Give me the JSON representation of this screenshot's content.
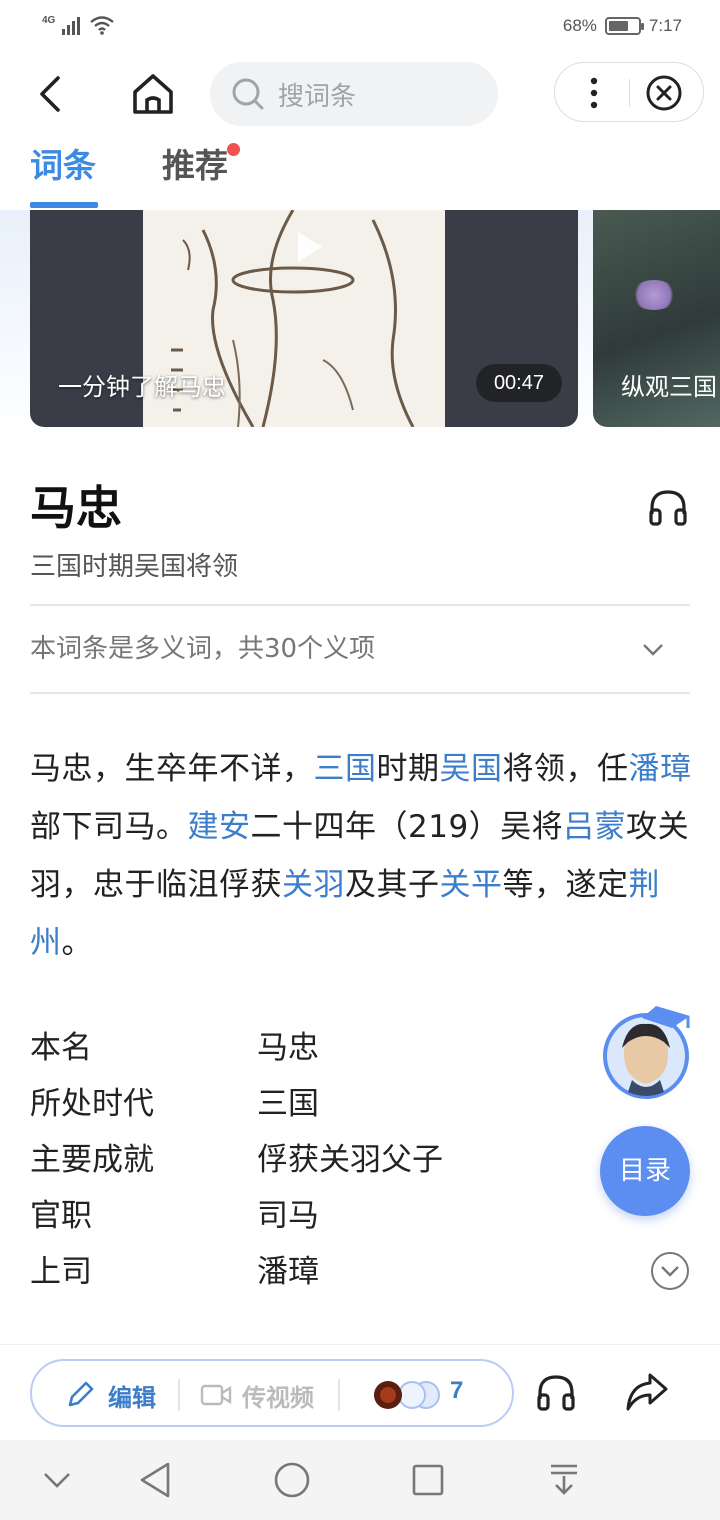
{
  "status": {
    "network": "4G",
    "battery": "68%",
    "battery_level": 0.68,
    "time": "7:17"
  },
  "search": {
    "placeholder": "搜词条"
  },
  "tabs": [
    {
      "label": "词条",
      "active": true
    },
    {
      "label": "推荐",
      "has_dot": true
    }
  ],
  "videos": [
    {
      "caption": "一分钟了解马忠",
      "duration": "00:47"
    },
    {
      "caption": "纵观三国"
    }
  ],
  "entry": {
    "title": "马忠",
    "subtitle": "三国时期吴国将领",
    "polysemy": "本词条是多义词，共30个义项"
  },
  "summary": {
    "t1": "马忠，生卒年不详，",
    "l1": "三国",
    "t2": "时期",
    "l2": "吴国",
    "t3": "将领，任",
    "l3": "潘璋",
    "t4": "部下司马。",
    "l4": "建安",
    "t5": "二十四年（219）吴将",
    "l5": "吕蒙",
    "t6": "攻关羽，忠于临沮俘获",
    "l6": "关羽",
    "t7": "及其子",
    "l7": "关平",
    "t8": "等，遂定",
    "l8": "荆州",
    "t9": "。"
  },
  "info": [
    {
      "key": "本名",
      "value": "马忠"
    },
    {
      "key": "所处时代",
      "value": "三国"
    },
    {
      "key": "主要成就",
      "value": "俘获关羽父子"
    },
    {
      "key": "官职",
      "value": "司马"
    },
    {
      "key": "上司",
      "value": "潘璋"
    }
  ],
  "toc_label": "目录",
  "actionbar": {
    "edit_label": "编辑",
    "video_label": "传视频",
    "contributors": "7"
  },
  "colors": {
    "accent": "#3c8ae3",
    "link": "#3c7ec9",
    "toc": "#5b8ef0",
    "dot": "#f25151"
  }
}
